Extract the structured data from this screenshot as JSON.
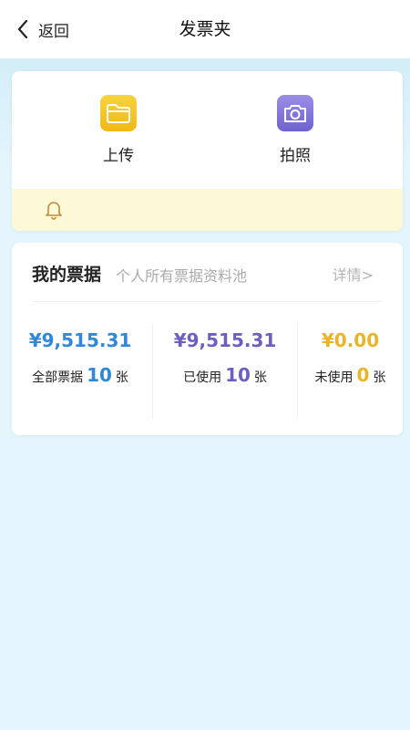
{
  "navbar": {
    "back_label": "返回",
    "title": "发票夹"
  },
  "actions": {
    "upload_label": "上传",
    "camera_label": "拍照"
  },
  "bills": {
    "title": "我的票据",
    "subtitle": "个人所有票据资料池",
    "detail_label": "详情>",
    "stats": {
      "all": {
        "amount": "¥9,515.31",
        "label": "全部票据",
        "count": "10",
        "unit": "张"
      },
      "used": {
        "amount": "¥9,515.31",
        "label": "已使用",
        "count": "10",
        "unit": "张"
      },
      "unused": {
        "amount": "¥0.00",
        "label": "未使用",
        "count": "0",
        "unit": "张"
      }
    }
  },
  "colors": {
    "all": "#2f88d8",
    "used": "#6b5fc0",
    "unused": "#ebb427",
    "notice_bg": "#fdf8d6"
  },
  "icons": [
    "chevron-left-icon",
    "folder-icon",
    "camera-icon",
    "bell-icon"
  ]
}
